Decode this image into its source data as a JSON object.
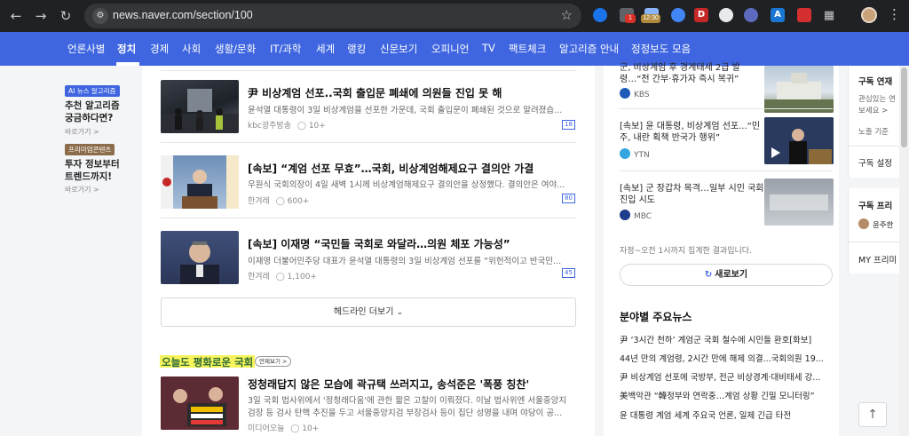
{
  "browser": {
    "url": "news.naver.com/section/100",
    "ext_badges": [
      "1",
      "12:30"
    ],
    "ext_letters": [
      "D",
      "A"
    ]
  },
  "category_nav": {
    "items": [
      "언론사별",
      "정치",
      "경제",
      "사회",
      "생활/문화",
      "IT/과학",
      "세계",
      "랭킹",
      "신문보기",
      "오피니언",
      "TV",
      "팩트체크",
      "알고리즘 안내",
      "정정보도 모음"
    ],
    "active": "정치",
    "bg_color": "#3f66e0"
  },
  "left_promos": [
    {
      "tag": "AI 뉴스 알고리즘",
      "text": [
        "추천 알고리즘",
        "궁금하다면?"
      ],
      "link": "바로가기 >",
      "tag_color": "#3f66e0"
    },
    {
      "tag": "프리미엄콘텐츠",
      "text": [
        "투자 정보부터",
        "트렌드까지!"
      ],
      "link": "바로가기 >",
      "tag_color": "#8c6d4b"
    }
  ],
  "articles": [
    {
      "title": "尹 비상계엄 선포..국회 출입문 폐쇄에 의원들 진입 못 해",
      "summary": "윤석열 대통령이 3일 비상계엄을 선포한 가운데, 국회 출입문이 폐쇄된 것으로 알려졌습...",
      "press": "kbc광주방송",
      "comments": "10+",
      "count": "18"
    },
    {
      "title": "[속보] “계엄 선포 무효”…국회, 비상계엄해제요구 결의안 가결",
      "summary": "우원식 국회의장이 4일 새벽 1시께 비상계엄해제요구 결의안을 상정했다. 결의안은 여야...",
      "press": "한겨레",
      "comments": "600+",
      "count": "80"
    },
    {
      "title": "[속보] 이재명 “국민들 국회로 와달라…의원 체포 가능성”",
      "summary": "이재명 더불어민주당 대표가 윤석열 대통령의 3일 비상계엄 선포를 “위헌적이고 반국민...",
      "press": "한겨레",
      "comments": "1,100+",
      "count": "45"
    }
  ],
  "headline_more": "헤드라인 더보기",
  "today_section": {
    "title": "오늘도 평화로운 국회",
    "tag": "언제보기 >",
    "article": {
      "title": "정청래답지 않은 모습에 곽규택 쓰러지고, 송석준은 '폭풍 칭찬'",
      "summary1": "3일 국회 법사위에서 '정청래다움'에 관한 짧은 고찰이 이뤄졌다. 이날 법사위엔 서울중앙지",
      "summary2": "검장 등 검사 탄핵 추진을 두고 서울중앙지검 부장검사 등이 집단 성명을 내며 야당이 공...",
      "press": "미디어오늘",
      "comments": "10+"
    }
  },
  "right_news": [
    {
      "title": [
        "군, 비상계엄 후 경계태세 2급 발",
        "령…“전 간부·휴가자 즉시 복귀”"
      ],
      "press": "KBS",
      "logo_color": "#1e5bb8"
    },
    {
      "title": [
        "[속보] 윤 대통령, 비상계엄 선포...“민",
        "주, 내란 획책 반국가 행위”"
      ],
      "press": "YTN",
      "logo_color": "#35a6e0"
    },
    {
      "title": [
        "[속보] 군 장갑차 목격…일부 시민 국회",
        "진입 시도"
      ],
      "press": "MBC",
      "logo_color": "#1e3c8c"
    }
  ],
  "right_note": "자정~오전 1시까지 집계한 결과입니다.",
  "refresh_label": "새로보기",
  "field_news": {
    "title": "분야별 주요뉴스",
    "items": [
      "尹 ‘3시간 천하’ 계엄군 국회 철수에 시민들 환호[화보]",
      "44년 만의 계엄령, 2시간 만에 해제 의결...국회의원 19...",
      "尹 비상계엄 선포에 국방부, 전군 비상경계·대비태세 강...",
      "美백악관 “韓정부와 연락중…계엄 상황 긴밀 모니터링”",
      "윤 대통령 계엄 세계 주요국 언론, 일제 긴급 타전"
    ]
  },
  "subscribe": {
    "title": "구독 연재",
    "desc": [
      "관심있는 연",
      "보세요 >"
    ],
    "sort": "노출 기준",
    "settings": "구독 설정",
    "premium_title": "구독 프리",
    "premium_author": "윤주한",
    "my_premium": "MY 프리미"
  }
}
